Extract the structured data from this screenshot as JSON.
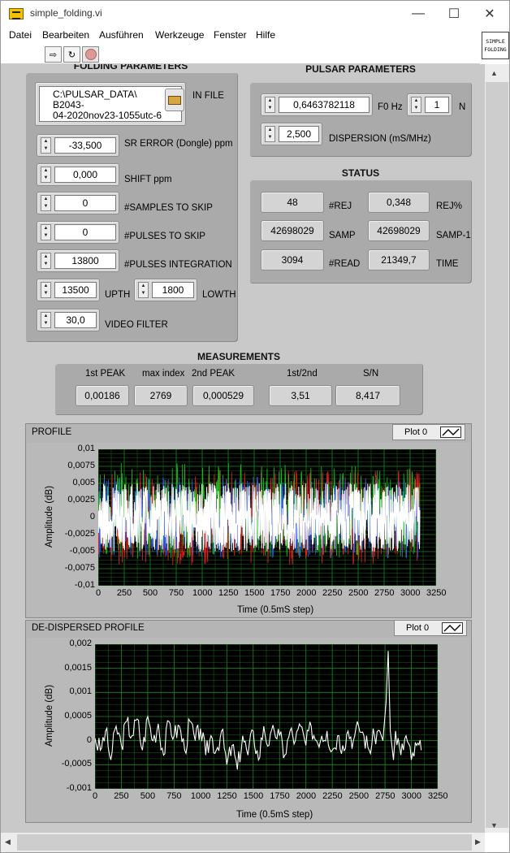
{
  "window": {
    "title": "simple_folding.vi",
    "minimize": "—",
    "maximize": "☐",
    "close": "✕"
  },
  "menu": [
    "Datei",
    "Bearbeiten",
    "Ausführen",
    "Werkzeuge",
    "Fenster",
    "Hilfe"
  ],
  "vi_icon": {
    "line1": "SIMPLE",
    "line2": "FOLDING"
  },
  "folding": {
    "title": "FOLDING PARAMETERS",
    "in_file": {
      "label": "IN FILE",
      "line1": "C:\\PULSAR_DATA\\",
      "line2": "B2043-",
      "line3": "04-2020nov23-1055utc-6"
    },
    "sr_error": {
      "label": "SR ERROR (Dongle) ppm",
      "value": "-33,500"
    },
    "shift": {
      "label": "SHIFT ppm",
      "value": "0,000"
    },
    "samples_skip": {
      "label": "#SAMPLES TO SKIP",
      "value": "0"
    },
    "pulses_skip": {
      "label": "#PULSES TO SKIP",
      "value": "0"
    },
    "pulses_int": {
      "label": "#PULSES INTEGRATION",
      "value": "13800"
    },
    "upth": {
      "label": "UPTH",
      "value": "13500"
    },
    "lowth": {
      "label": "LOWTH",
      "value": "1800"
    },
    "video": {
      "label": "VIDEO FILTER",
      "value": "30,0"
    }
  },
  "pulsar": {
    "title": "PULSAR PARAMETERS",
    "f0": {
      "label": "F0 Hz",
      "value": "0,6463782118"
    },
    "n": {
      "label": "N",
      "value": "1"
    },
    "dispersion": {
      "label": "DISPERSION (mS/MHz)",
      "value": "2,500"
    }
  },
  "status": {
    "title": "STATUS",
    "rej": {
      "label": "#REJ",
      "value": "48"
    },
    "rejp": {
      "label": "REJ%",
      "value": "0,348"
    },
    "samp": {
      "label": "SAMP",
      "value": "42698029"
    },
    "samp1": {
      "label": "SAMP-1",
      "value": "42698029"
    },
    "read": {
      "label": "#READ",
      "value": "3094"
    },
    "time": {
      "label": "TIME",
      "value": "21349,7"
    }
  },
  "measurements": {
    "title": "MEASUREMENTS",
    "peak1": {
      "label": "1st PEAK",
      "value": "0,00186"
    },
    "maxidx": {
      "label": "max index",
      "value": "2769"
    },
    "peak2": {
      "label": "2nd PEAK",
      "value": "0,000529"
    },
    "ratio": {
      "label": "1st/2nd",
      "value": "3,51"
    },
    "sn": {
      "label": "S/N",
      "value": "8,417"
    }
  },
  "colors": {
    "plot_bg": "#000000",
    "grid": "#1f8a1f",
    "trace_white": "#ffffff",
    "trace_red": "#ff2020",
    "trace_green": "#20d020",
    "trace_blue": "#3060ff"
  },
  "chart_data": [
    {
      "type": "line",
      "title": "PROFILE",
      "legend": "Plot 0",
      "xlabel": "Time (0.5mS step)",
      "ylabel": "Amplitude (dB)",
      "xlim": [
        0,
        3250
      ],
      "ylim": [
        -0.01,
        0.01
      ],
      "x_ticks": [
        "0",
        "250",
        "500",
        "750",
        "1000",
        "1250",
        "1500",
        "1750",
        "2000",
        "2250",
        "2500",
        "2750",
        "3000",
        "3250"
      ],
      "y_ticks": [
        "0,01",
        "0,0075",
        "0,005",
        "0,0025",
        "0",
        "-0,0025",
        "-0,005",
        "-0,0075",
        "-0,01"
      ],
      "data_x_range": [
        0,
        3094
      ],
      "series": [
        {
          "color": "white",
          "band": [
            -0.005,
            0.005
          ]
        },
        {
          "color": "red",
          "band": [
            -0.007,
            0.007
          ]
        },
        {
          "color": "green",
          "band": [
            -0.006,
            0.008
          ]
        },
        {
          "color": "blue",
          "band": [
            -0.006,
            0.006
          ]
        }
      ],
      "grid": true
    },
    {
      "type": "line",
      "title": "DE-DISPERSED PROFILE",
      "legend": "Plot 0",
      "xlabel": "Time (0.5mS step)",
      "ylabel": "Amplitude (dB)",
      "xlim": [
        0,
        3250
      ],
      "ylim": [
        -0.001,
        0.002
      ],
      "x_ticks": [
        "0",
        "250",
        "500",
        "750",
        "1000",
        "1250",
        "1500",
        "1750",
        "2000",
        "2250",
        "2500",
        "2750",
        "3000",
        "3250"
      ],
      "y_ticks": [
        "0,002",
        "0,0015",
        "0,001",
        "0,0005",
        "0",
        "-0,0005",
        "-0,001"
      ],
      "x": [
        0,
        50,
        100,
        150,
        200,
        250,
        300,
        350,
        400,
        450,
        500,
        550,
        600,
        650,
        700,
        750,
        800,
        850,
        900,
        950,
        1000,
        1050,
        1100,
        1150,
        1200,
        1250,
        1300,
        1350,
        1400,
        1450,
        1500,
        1550,
        1600,
        1650,
        1700,
        1750,
        1800,
        1850,
        1900,
        1950,
        2000,
        2050,
        2100,
        2150,
        2200,
        2250,
        2300,
        2350,
        2400,
        2450,
        2500,
        2550,
        2600,
        2650,
        2700,
        2730,
        2760,
        2780,
        2800,
        2830,
        2850,
        2900,
        2950,
        3000,
        3050,
        3094
      ],
      "y": [
        5e-05,
        -0.0002,
        0.0002,
        -0.0004,
        0.0003,
        -0.0001,
        0.0004,
        0.0001,
        0.00045,
        -0.0002,
        0.0005,
        0.0,
        0.00035,
        -0.0003,
        0.0004,
        0.0001,
        0.0003,
        -0.0002,
        0.0004,
        0.0,
        0.00025,
        -0.0003,
        0.0001,
        -0.0002,
        0.0002,
        -0.0005,
        -0.0001,
        -0.0006,
        0.0001,
        -0.0003,
        0.0002,
        -0.0004,
        0.0003,
        -0.0001,
        0.0002,
        0.0001,
        -0.0003,
        0.0002,
        0.0,
        0.0003,
        -0.0001,
        0.0003,
        0.0,
        0.0001,
        0.0002,
        -0.0002,
        0.0001,
        -0.0001,
        0.0002,
        0.0,
        0.0003,
        0.0001,
        -0.0002,
        0.0001,
        0.0002,
        0.0,
        0.0008,
        0.00186,
        0.0002,
        -0.0004,
        0.0002,
        -0.0003,
        0.0001,
        -0.0004,
        -0.0001,
        -0.0002
      ],
      "grid": true
    }
  ]
}
